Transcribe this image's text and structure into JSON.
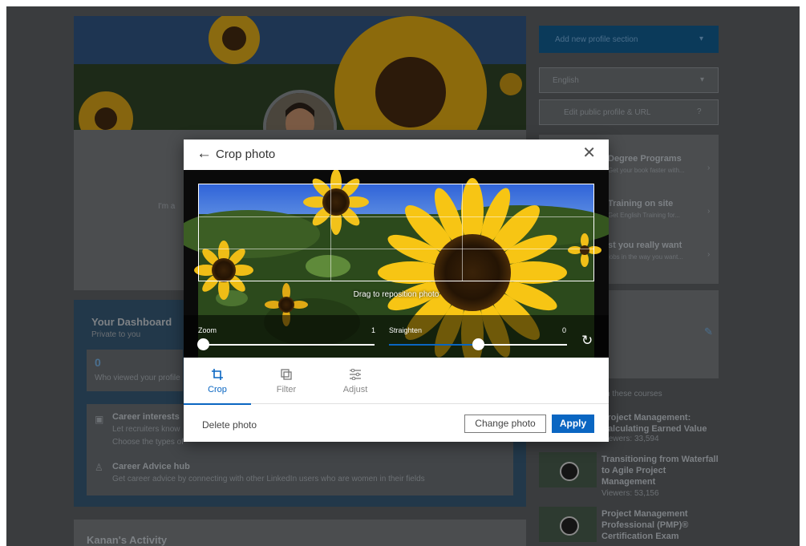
{
  "background": {
    "intro_text": "I'm a",
    "sidebar": {
      "add_section_label": "Add new profile section",
      "language_value": "English",
      "public_profile_label": "Edit public profile & URL",
      "promos": [
        {
          "title": "Degree Programs",
          "desc": "Get your book faster with..."
        },
        {
          "title": "Training on site",
          "desc": "Get English Training for..."
        },
        {
          "title": "st you really want",
          "desc": "jobs in the way you want..."
        }
      ],
      "courses_header": "ch these courses",
      "courses": [
        {
          "title": "Project Management: Calculating Earned Value",
          "viewers": "Viewers: 33,594"
        },
        {
          "title": "Transitioning from Waterfall to Agile Project Management",
          "viewers": "Viewers: 53,156"
        },
        {
          "title": "Project Management Professional (PMP)® Certification Exam",
          "viewers": ""
        }
      ]
    },
    "dashboard": {
      "title": "Your Dashboard",
      "subtitle": "Private to you",
      "views_count": "0",
      "views_label": "Who viewed your profile",
      "career_interests_title": "Career interests",
      "career_interests_desc": "Let recruiters know",
      "career_interests_sub": "Choose the types of",
      "career_advice_title": "Career Advice hub",
      "career_advice_desc": "Get career advice by connecting with other LinkedIn users who are women in their fields"
    },
    "activity_title": "Kanan's Activity"
  },
  "modal": {
    "back_icon": "arrow-left-icon",
    "title": "Crop photo",
    "close_icon": "close-icon",
    "drag_hint": "Drag to reposition photo",
    "zoom_label": "Zoom",
    "zoom_value": "1",
    "straighten_label": "Straighten",
    "straighten_value": "0",
    "zoom_level": 0,
    "straighten_level": 0.5,
    "tabs": [
      {
        "label": "Crop",
        "icon": "crop-icon",
        "active": true
      },
      {
        "label": "Filter",
        "icon": "filter-icon",
        "active": false
      },
      {
        "label": "Adjust",
        "icon": "sliders-icon",
        "active": false
      }
    ],
    "delete_label": "Delete photo",
    "change_label": "Change photo",
    "apply_label": "Apply",
    "accent_color": "#0a66c2"
  }
}
